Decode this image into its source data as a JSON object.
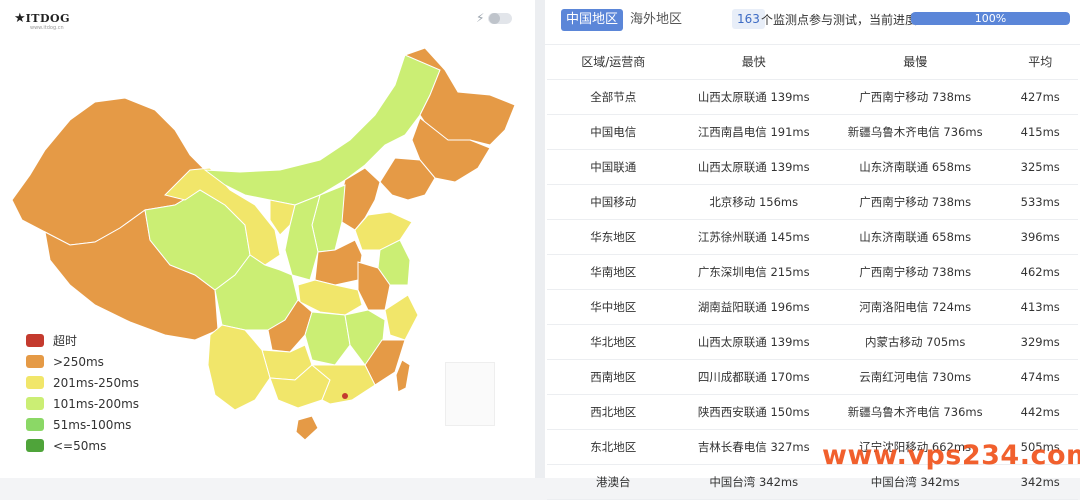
{
  "logo": {
    "brand": "ITDOG",
    "sub": "www.itdog.cn"
  },
  "toggle": {
    "icon": "bolt-icon",
    "state": "off"
  },
  "legend": {
    "items": [
      {
        "label": "超时",
        "color": "#c43a2e"
      },
      {
        "label": ">250ms",
        "color": "#e59a46"
      },
      {
        "label": "201ms-250ms",
        "color": "#f1e66a"
      },
      {
        "label": "101ms-200ms",
        "color": "#cbee74"
      },
      {
        "label": "51ms-100ms",
        "color": "#8bd866"
      },
      {
        "label": "<=50ms",
        "color": "#4fa43a"
      }
    ]
  },
  "tabs": {
    "active": "中国地区",
    "other": "海外地区"
  },
  "progress": {
    "count": "163",
    "text": "个监测点参与测试，当前进度：",
    "percent_label": "100%",
    "value": 100
  },
  "table": {
    "headers": [
      "区域/运营商",
      "最快",
      "最慢",
      "平均"
    ],
    "rows": [
      [
        "全部节点",
        "山西太原联通 139ms",
        "广西南宁移动 738ms",
        "427ms"
      ],
      [
        "中国电信",
        "江西南昌电信 191ms",
        "新疆乌鲁木齐电信 736ms",
        "415ms"
      ],
      [
        "中国联通",
        "山西太原联通 139ms",
        "山东济南联通 658ms",
        "325ms"
      ],
      [
        "中国移动",
        "北京移动 156ms",
        "广西南宁移动 738ms",
        "533ms"
      ],
      [
        "华东地区",
        "江苏徐州联通 145ms",
        "山东济南联通 658ms",
        "396ms"
      ],
      [
        "华南地区",
        "广东深圳电信 215ms",
        "广西南宁移动 738ms",
        "462ms"
      ],
      [
        "华中地区",
        "湖南益阳联通 196ms",
        "河南洛阳电信 724ms",
        "413ms"
      ],
      [
        "华北地区",
        "山西太原联通 139ms",
        "内蒙古移动 705ms",
        "329ms"
      ],
      [
        "西南地区",
        "四川成都联通 170ms",
        "云南红河电信 730ms",
        "474ms"
      ],
      [
        "西北地区",
        "陕西西安联通 150ms",
        "新疆乌鲁木齐电信 736ms",
        "442ms"
      ],
      [
        "东北地区",
        "吉林长春电信 327ms",
        "辽宁沈阳移动 662ms",
        "505ms"
      ],
      [
        "港澳台",
        "中国台湾 342ms",
        "中国台湾 342ms",
        "342ms"
      ]
    ]
  },
  "watermark": "www.vps234.com"
}
